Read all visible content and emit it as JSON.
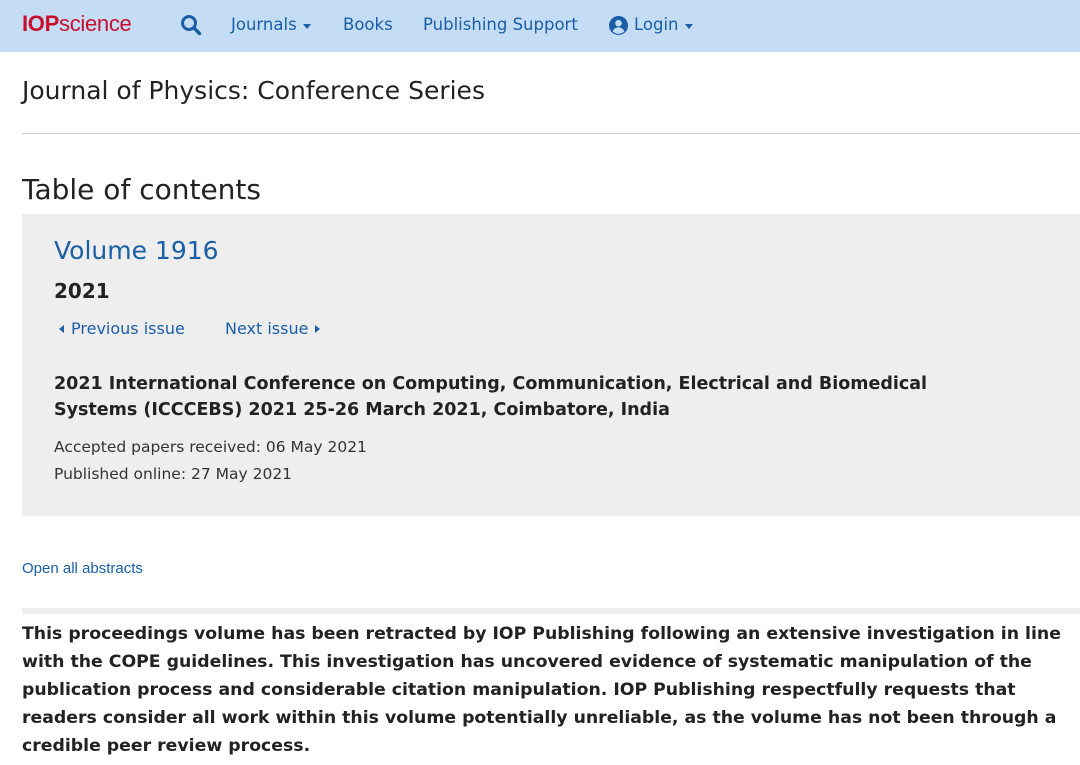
{
  "brand": {
    "logo_bold": "IOP",
    "logo_rest": "science",
    "accent_color": "#c8102e"
  },
  "nav": {
    "search_icon": "search-icon",
    "journals_label": "Journals",
    "books_label": "Books",
    "support_label": "Publishing Support",
    "login_label": "Login",
    "link_color": "#1a5fa6",
    "bar_color": "#c5dcf5"
  },
  "journal": {
    "title": "Journal of Physics: Conference Series"
  },
  "toc": {
    "heading": "Table of contents"
  },
  "volume": {
    "title": "Volume 1916",
    "year": "2021",
    "previous_label": "Previous issue",
    "next_label": "Next issue",
    "conference": "2021 International Conference on Computing, Communication, Electrical and Biomedical Systems (ICCCEBS) 2021 25-26 March 2021, Coimbatore, India",
    "accepted": "Accepted papers received: 06 May 2021",
    "published": "Published online: 27 May 2021"
  },
  "abstracts": {
    "open_all_label": "Open all abstracts"
  },
  "retraction": {
    "notice": "This proceedings volume has been retracted by IOP Publishing following an extensive investigation in line with the COPE guidelines. This investigation has uncovered evidence of systematic manipulation of the publication process and considerable citation manipulation. IOP Publishing respectfully requests that readers consider all work within this volume potentially unreliable, as the volume has not been through a credible peer review process."
  }
}
